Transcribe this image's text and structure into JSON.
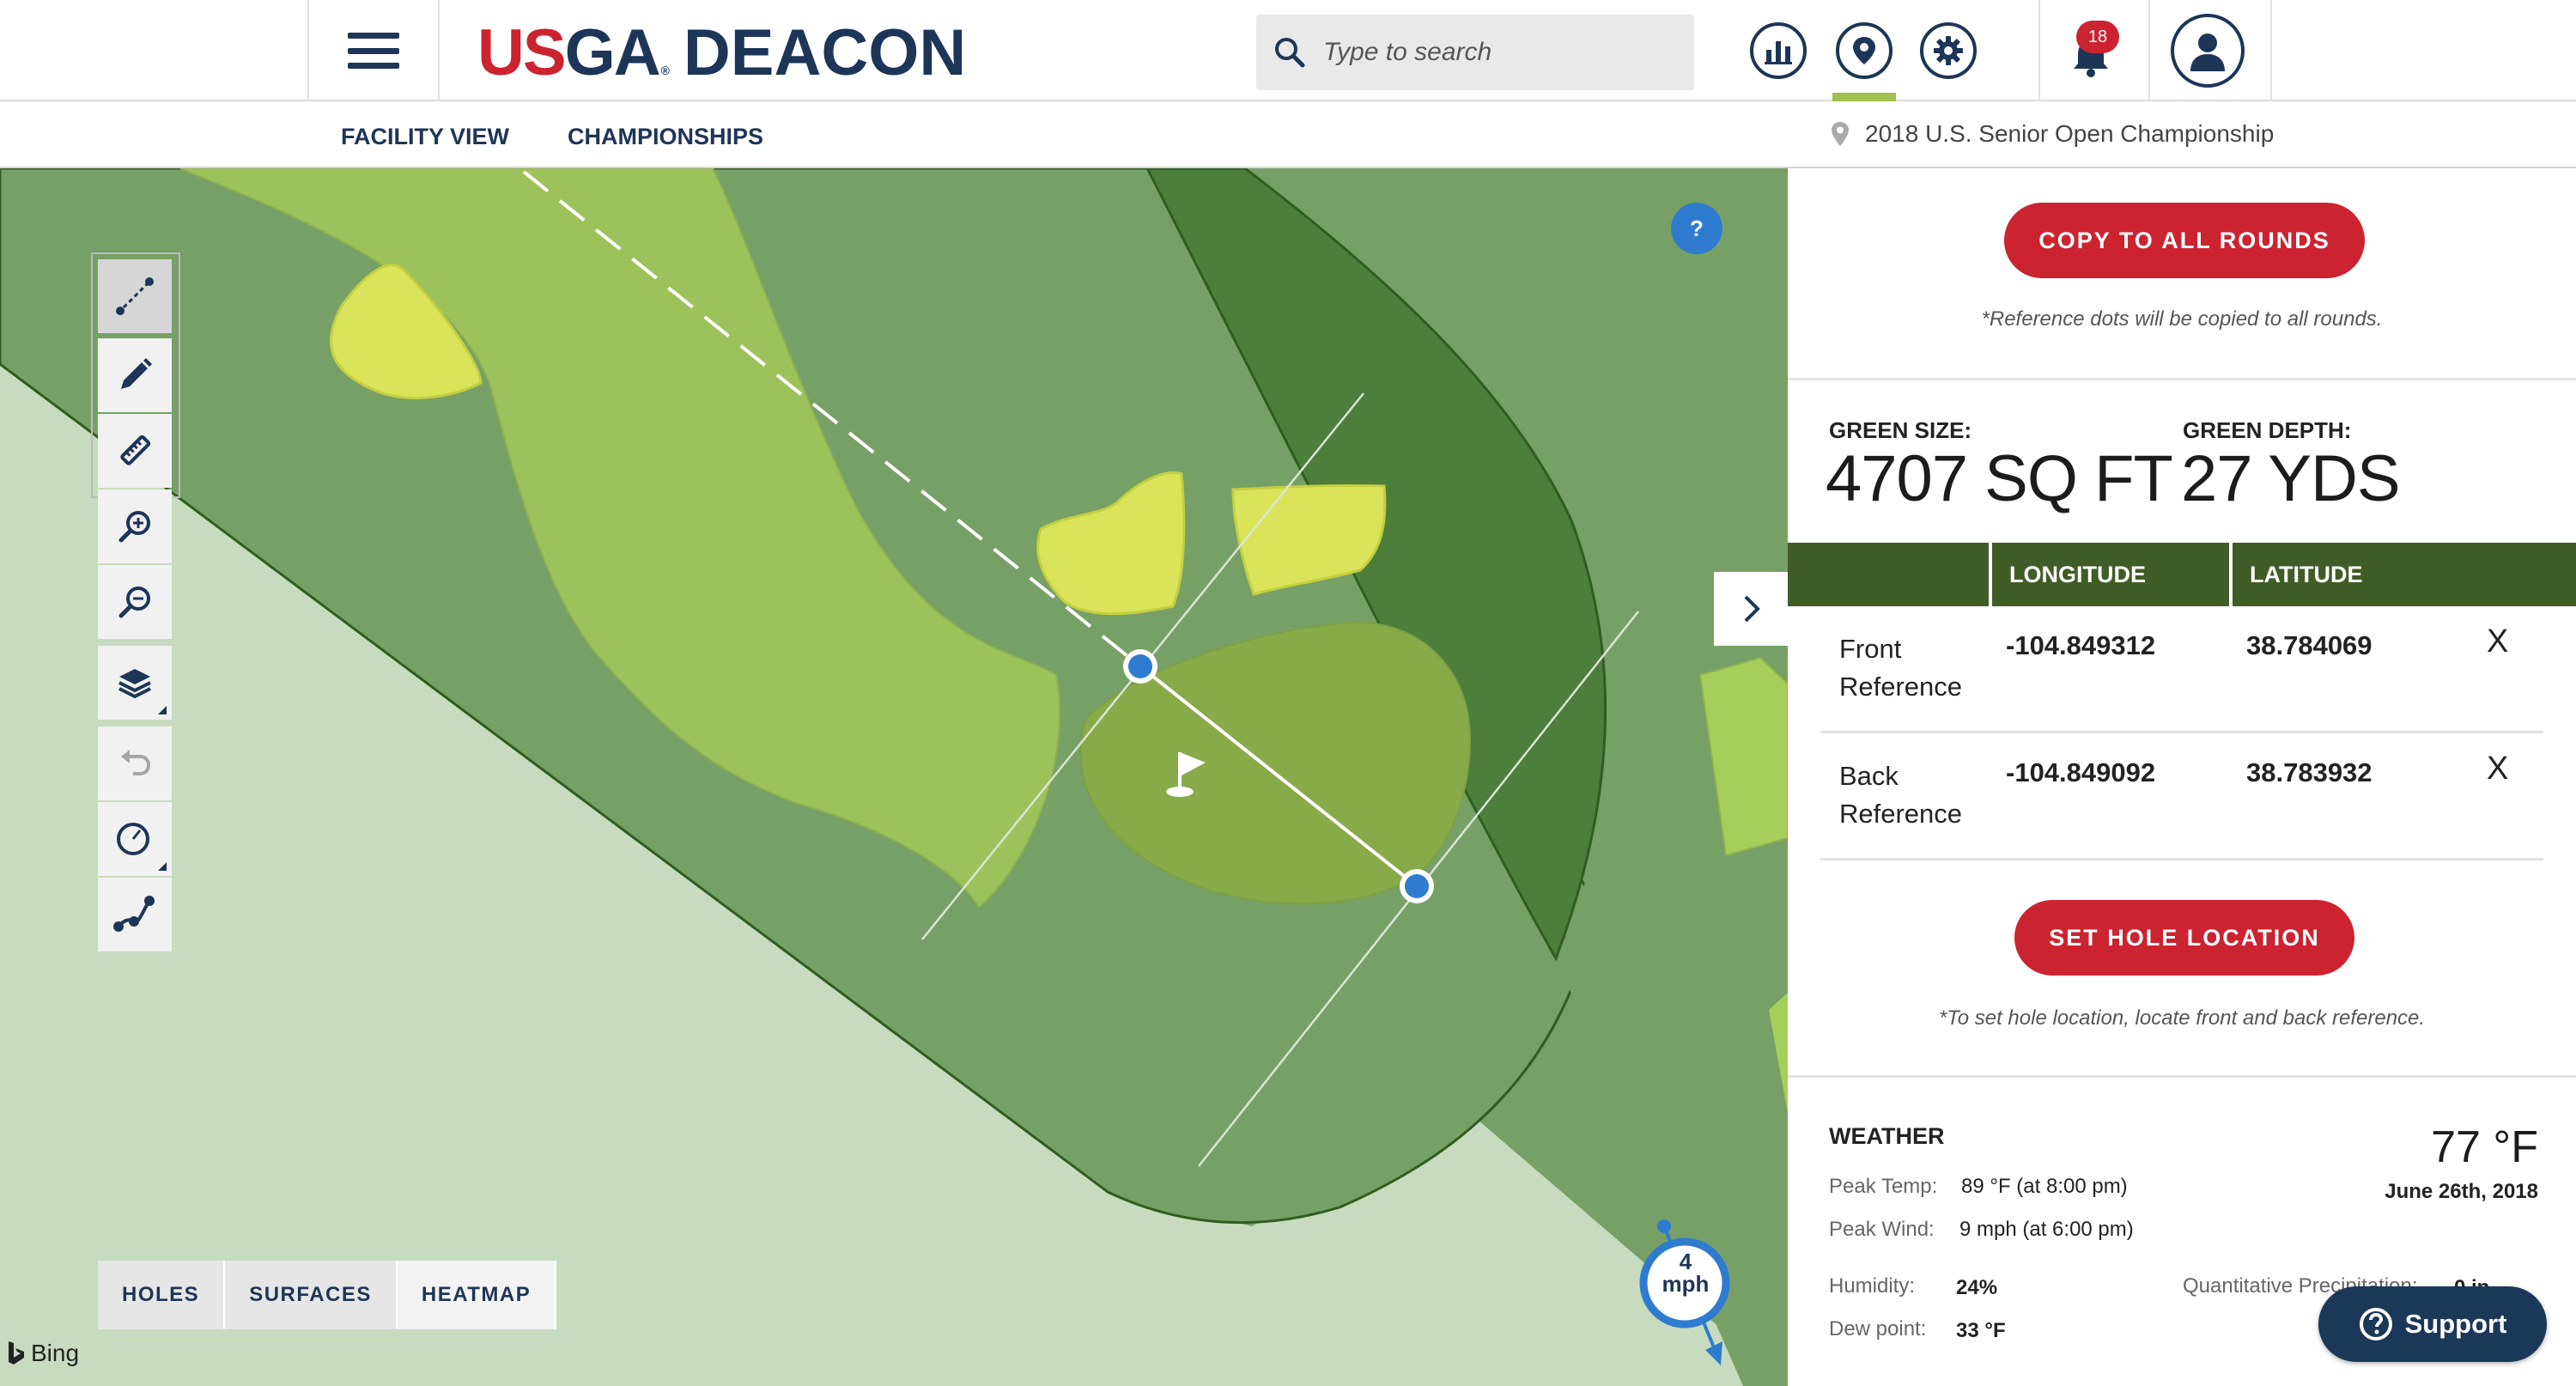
{
  "header": {
    "logo_us": "US",
    "logo_ga": "GA",
    "logo_reg": "®",
    "logo_product": "DEACON",
    "search_placeholder": "Type to search",
    "notification_count": "18"
  },
  "subnav": {
    "facility_view": "FACILITY VIEW",
    "championships": "CHAMPIONSHIPS",
    "event_name": "2018 U.S. Senior Open Championship"
  },
  "map": {
    "help_label": "?",
    "layer_tabs": [
      "HOLES",
      "SURFACES",
      "HEATMAP"
    ],
    "attribution": "Bing",
    "wind_speed": "4",
    "wind_unit": "mph"
  },
  "panel": {
    "copy_button": "COPY TO ALL ROUNDS",
    "copy_note": "*Reference dots will be copied to all rounds.",
    "green_size_label": "GREEN SIZE:",
    "green_size_value": "4707 SQ FT",
    "green_depth_label": "GREEN DEPTH:",
    "green_depth_value": "27 YDS",
    "table_headers": {
      "longitude": "LONGITUDE",
      "latitude": "LATITUDE"
    },
    "references": [
      {
        "name": "Front Reference",
        "longitude": "-104.849312",
        "latitude": "38.784069",
        "delete": "X"
      },
      {
        "name": "Back Reference",
        "longitude": "-104.849092",
        "latitude": "38.783932",
        "delete": "X"
      }
    ],
    "set_button": "SET HOLE LOCATION",
    "set_note": "*To set hole location, locate front and back reference."
  },
  "weather": {
    "title": "WEATHER",
    "current_temp": "77 °F",
    "date": "June 26th, 2018",
    "peak_temp_label": "Peak Temp:",
    "peak_temp_value": "89 °F (at 8:00 pm)",
    "peak_wind_label": "Peak Wind:",
    "peak_wind_value": "9 mph (at 6:00 pm)",
    "humidity_label": "Humidity:",
    "humidity_value": "24%",
    "dew_point_label": "Dew point:",
    "dew_point_value": "33 °F",
    "precip_label": "Quantitative Precipitation:",
    "precip_value": "0 in"
  },
  "support": {
    "label": "Support"
  },
  "colors": {
    "navy": "#1d3557",
    "red": "#cc2330",
    "accent_green": "#a3bf4e",
    "table_header": "#3f5d26",
    "rough": "#77a066",
    "fairway": "#9cc25c",
    "bunker": "#d9e45a",
    "out_of_bounds": "#c7dbbe",
    "trees": "#4d7e3c"
  },
  "icons": [
    "menu-icon",
    "search-icon",
    "stats-icon",
    "location-icon",
    "settings-icon",
    "bell-icon",
    "user-icon",
    "pin-icon",
    "measure-line-icon",
    "pencil-icon",
    "ruler-icon",
    "zoom-in-icon",
    "zoom-out-icon",
    "layers-icon",
    "undo-icon",
    "circle-tool-icon",
    "path-tool-icon",
    "flag-icon",
    "chevron-right-icon",
    "question-icon",
    "bing-icon",
    "wind-icon"
  ]
}
